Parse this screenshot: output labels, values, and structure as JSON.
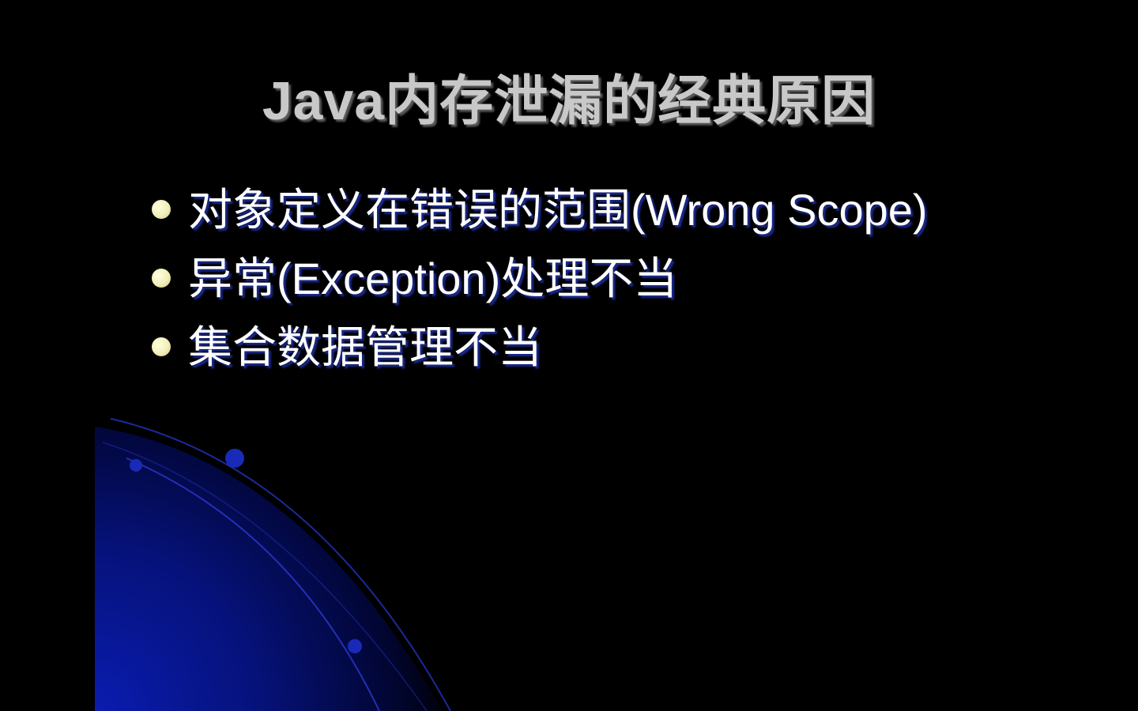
{
  "slide": {
    "title": "Java内存泄漏的经典原因",
    "bullets": [
      "对象定义在错误的范围(Wrong Scope)",
      "异常(Exception)处理不当",
      "集合数据管理不当"
    ]
  },
  "colors": {
    "background": "#000000",
    "title": "#c8c8c8",
    "bullet_text": "#ffffff",
    "bullet_dot": "#f2efb8",
    "accent_blue": "#0a1aa0"
  }
}
